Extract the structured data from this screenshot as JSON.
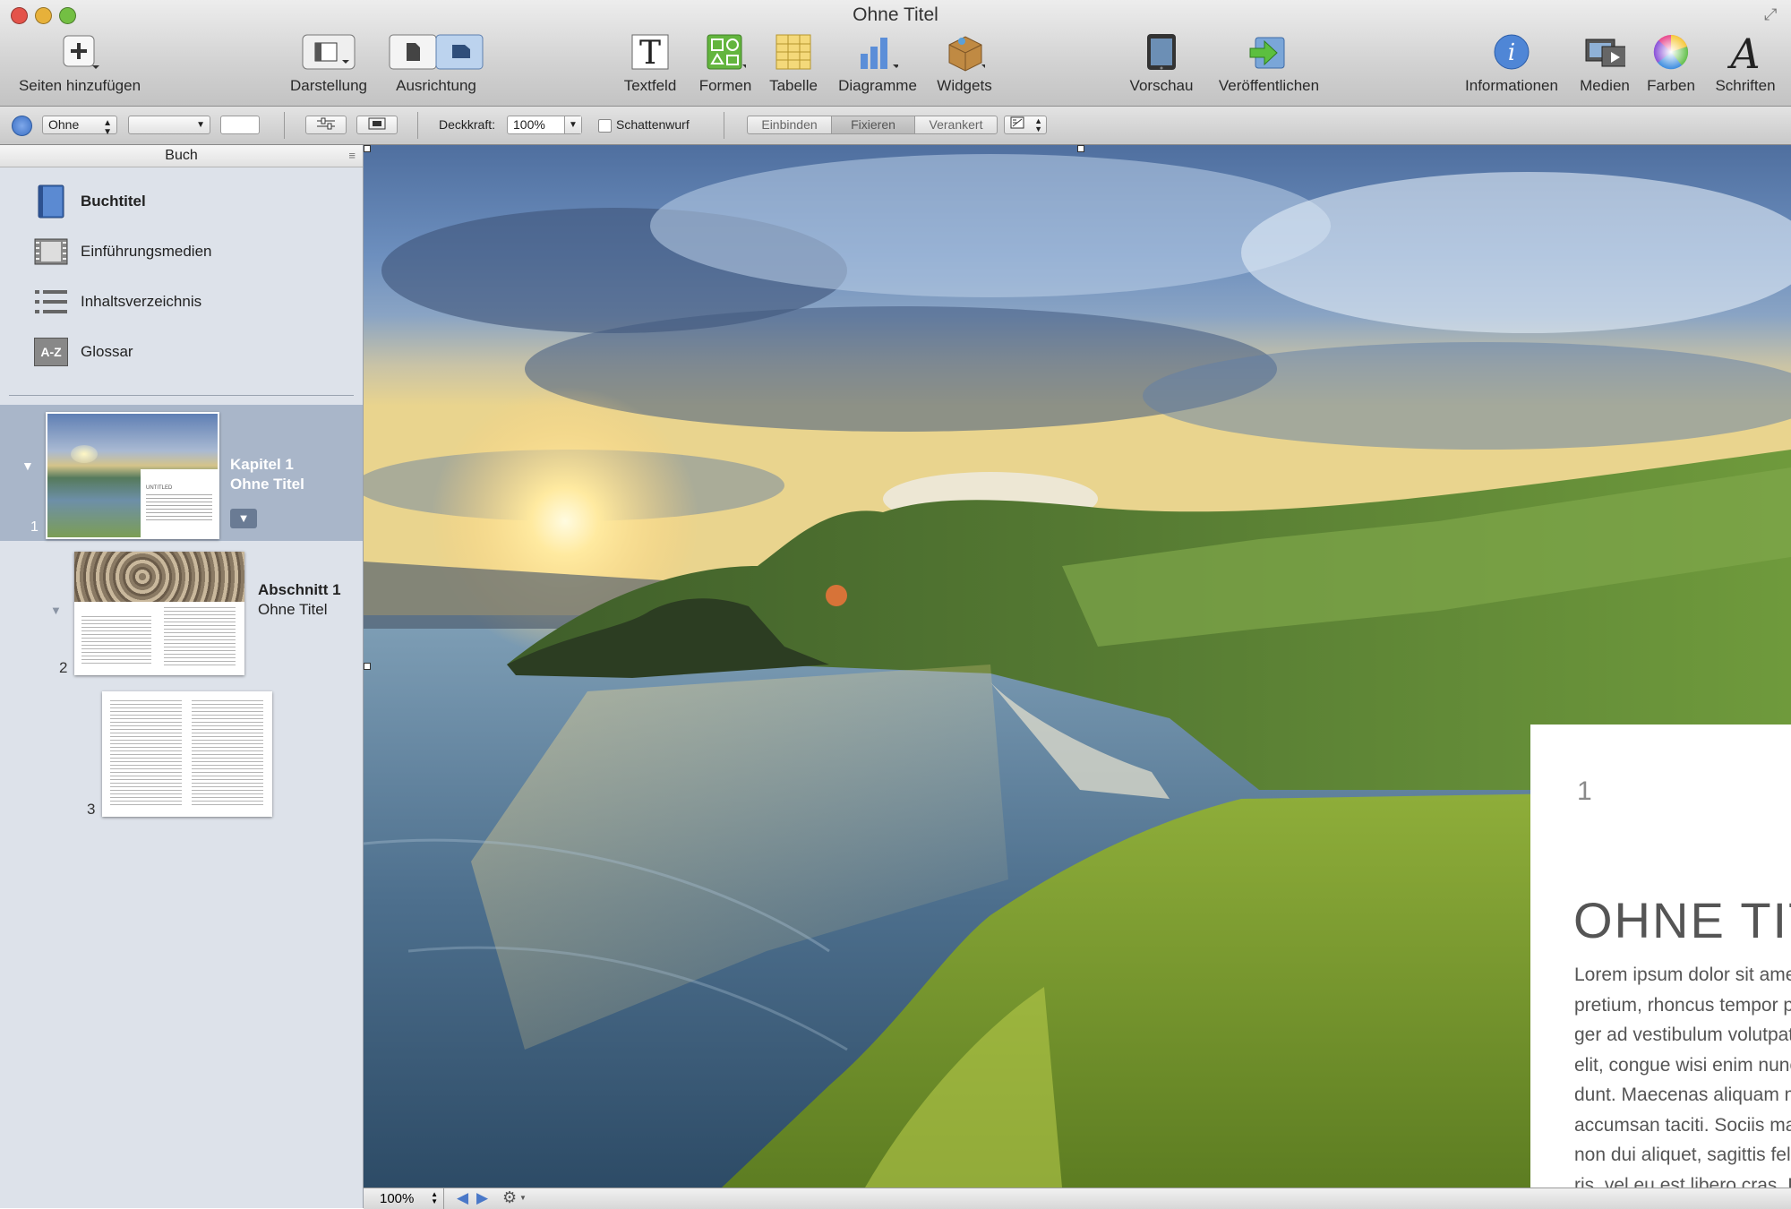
{
  "window": {
    "title": "Ohne Titel"
  },
  "toolbar": {
    "add_pages": "Seiten hinzufügen",
    "view": "Darstellung",
    "orientation": "Ausrichtung",
    "textbox": "Textfeld",
    "shapes": "Formen",
    "table": "Tabelle",
    "charts": "Diagramme",
    "widgets": "Widgets",
    "preview": "Vorschau",
    "publish": "Veröffentlichen",
    "inspector": "Informationen",
    "media": "Medien",
    "colors": "Farben",
    "fonts": "Schriften"
  },
  "formatbar": {
    "style_select": "Ohne",
    "opacity_label": "Deckkraft:",
    "opacity_value": "100%",
    "shadow_label": "Schattenwurf",
    "wrap_options": [
      "Einbinden",
      "Fixieren",
      "Verankert"
    ],
    "wrap_selected": "Fixieren"
  },
  "sidebar": {
    "header": "Buch",
    "items": [
      {
        "label": "Buchtitel",
        "icon": "book-icon",
        "selected": true
      },
      {
        "label": "Einführungsmedien",
        "icon": "film-icon"
      },
      {
        "label": "Inhaltsverzeichnis",
        "icon": "list-icon"
      },
      {
        "label": "Glossar",
        "icon": "az-icon",
        "icon_text": "A-Z"
      }
    ],
    "chapters": [
      {
        "number": "1",
        "title_line1": "Kapitel 1",
        "title_line2": "Ohne Titel"
      }
    ],
    "sections": [
      {
        "number": "2",
        "title_line1": "Abschnitt 1",
        "title_line2": "Ohne Titel"
      }
    ],
    "pages": [
      {
        "number": "3"
      }
    ],
    "thumb_caption": "UNTITLED"
  },
  "document": {
    "page_number": "1",
    "title": "OHNE TITEL",
    "body_lines": [
      "Lorem ipsum dolor sit amet, ligula suspendisse nulla",
      "pretium, rhoncus tempor placerat fermentum, enim inte-",
      "ger ad vestibulum volutpat. Nisl rhoncus turpis est, vel",
      "elit, congue wisi enim nunc ultricies sit, magna tinci-",
      "dunt. Maecenas aliquam maecenas ligula nostra,",
      "accumsan taciti. Sociis mauris in integer, a dolor netus",
      "non dui aliquet, sagittis felis sodales, dolor sociis mau-",
      "ris, vel eu est libero cras. Interdum at. Eget vel."
    ]
  },
  "statusbar": {
    "zoom": "100%"
  },
  "colors": {
    "accent": "#5a86d4",
    "selection": "#aab8cc",
    "title_gray": "#555555"
  }
}
